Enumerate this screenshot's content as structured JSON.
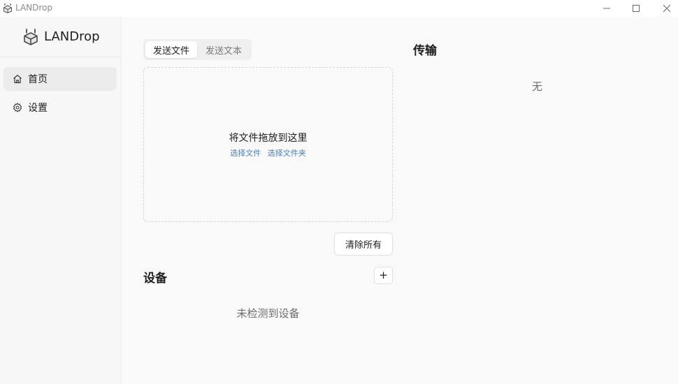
{
  "window": {
    "title": "LANDrop"
  },
  "sidebar": {
    "brand": "LANDrop",
    "items": [
      {
        "label": "首页",
        "icon": "home-icon",
        "active": true
      },
      {
        "label": "设置",
        "icon": "gear-icon",
        "active": false
      }
    ]
  },
  "send": {
    "tabs": [
      {
        "label": "发送文件",
        "active": true
      },
      {
        "label": "发送文本",
        "active": false
      }
    ],
    "dropzone_text": "将文件拖放到这里",
    "choose_files": "选择文件",
    "choose_folder": "选择文件夹",
    "clear_all": "清除所有"
  },
  "devices": {
    "title": "设备",
    "add_label": "+",
    "empty": "未检测到设备"
  },
  "transfer": {
    "title": "传输",
    "empty": "无"
  },
  "colors": {
    "accent_link": "#4a7fc1",
    "sidebar_bg": "#f7f7f7",
    "main_bg": "#f9f9f9"
  }
}
